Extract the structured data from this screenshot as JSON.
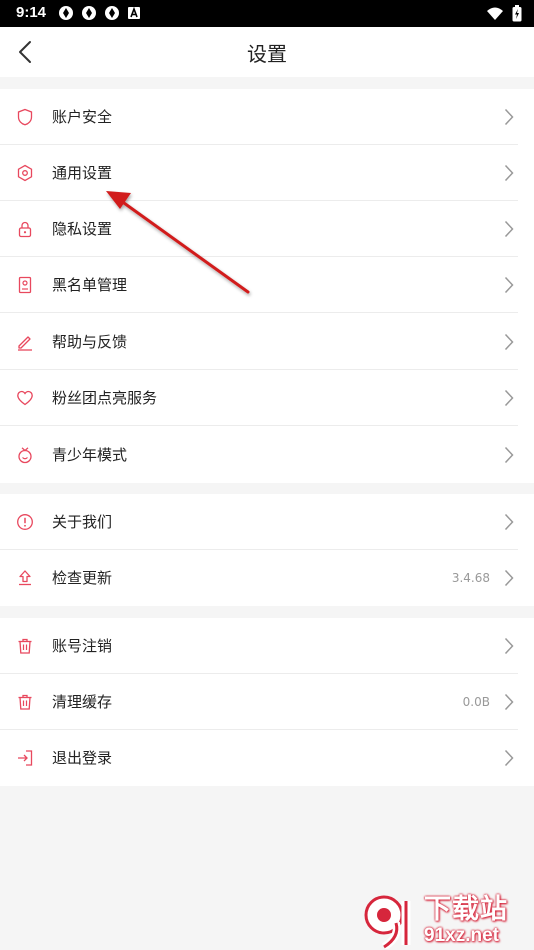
{
  "status_bar": {
    "time": "9:14"
  },
  "header": {
    "title": "设置"
  },
  "groups": [
    {
      "items": [
        {
          "label": "账户安全",
          "icon": "shield-icon"
        },
        {
          "label": "通用设置",
          "icon": "hexagon-settings-icon"
        },
        {
          "label": "隐私设置",
          "icon": "lock-icon"
        },
        {
          "label": "黑名单管理",
          "icon": "blacklist-book-icon"
        },
        {
          "label": "帮助与反馈",
          "icon": "pencil-icon"
        },
        {
          "label": "粉丝团点亮服务",
          "icon": "heart-icon"
        },
        {
          "label": "青少年模式",
          "icon": "youth-mode-icon"
        }
      ]
    },
    {
      "items": [
        {
          "label": "关于我们",
          "icon": "info-icon"
        },
        {
          "label": "检查更新",
          "icon": "upload-icon",
          "value": "3.4.68"
        }
      ]
    },
    {
      "items": [
        {
          "label": "账号注销",
          "icon": "trash-icon"
        },
        {
          "label": "清理缓存",
          "icon": "trash-icon",
          "value": "0.0B"
        },
        {
          "label": "退出登录",
          "icon": "logout-icon"
        }
      ]
    }
  ],
  "watermark": {
    "title": "下载站",
    "domain": "91xz.net"
  },
  "colors": {
    "accent": "#e8485e",
    "annotation_arrow": "#d11f1f",
    "chevron": "#999999"
  }
}
